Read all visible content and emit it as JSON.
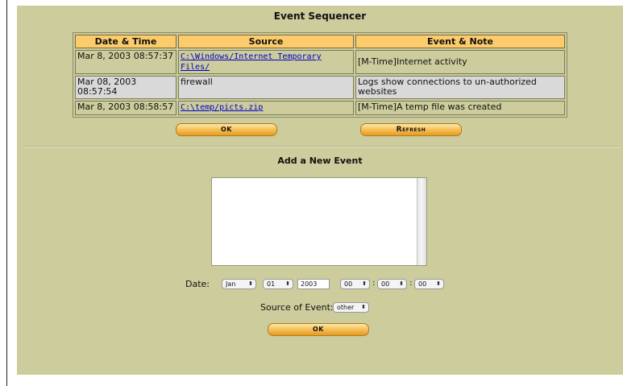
{
  "title": "Event Sequencer",
  "table": {
    "headers": [
      "Date & Time",
      "Source",
      "Event & Note"
    ],
    "rows": [
      {
        "datetime": "Mar 8, 2003 08:57:37",
        "source": "C:\\Windows/Internet Temporary Files/",
        "source_is_link": true,
        "note": "[M-Time]Internet activity"
      },
      {
        "datetime": "Mar 08, 2003 08:57:54",
        "source": "firewall",
        "source_is_link": false,
        "note": "Logs show connections to un-authorized websites"
      },
      {
        "datetime": "Mar 8, 2003 08:58:57",
        "source": "C:\\temp/picts.zip",
        "source_is_link": true,
        "note": "[M-Time]A temp file was created"
      }
    ]
  },
  "buttons": {
    "ok": "OK",
    "refresh": "Refresh",
    "add_ok": "OK"
  },
  "add_event": {
    "title": "Add a New Event",
    "date_label": "Date:",
    "month": "Jan",
    "day": "01",
    "year": "2003",
    "hour": "00",
    "minute": "00",
    "second": "00",
    "time_separator": ":",
    "source_label": "Source of Event:",
    "source_value": "other",
    "stepper_glyph": "⬍"
  },
  "colors": {
    "panel": "#cccc9c",
    "header": "#fccc6c",
    "button": "#f6be56",
    "link": "#0000cc"
  }
}
